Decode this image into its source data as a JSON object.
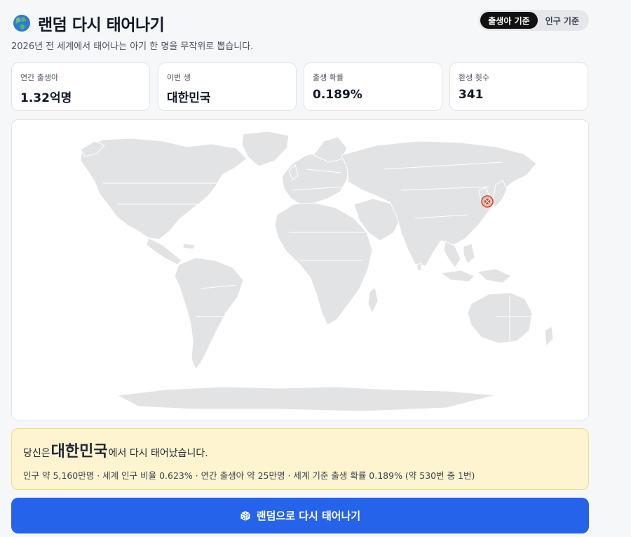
{
  "header": {
    "title": "랜덤 다시 태어나기",
    "subtitle": "2026년 전 세계에서 태어나는 아기 한 명을 무작위로 뽑습니다.",
    "toggle": [
      {
        "label": "출생아 기준",
        "active": true
      },
      {
        "label": "인구 기준",
        "active": false
      }
    ]
  },
  "stats": [
    {
      "label": "연간 출생아",
      "value": "1.32억명"
    },
    {
      "label": "이번 생",
      "value": "대한민국"
    },
    {
      "label": "출생 확률",
      "value": "0.189%"
    },
    {
      "label": "환생 횟수",
      "value": "341"
    }
  ],
  "map": {
    "land_color": "#e2e3e5",
    "marker_color": "#d9442c",
    "marker_icon": "location-pin-icon"
  },
  "result": {
    "prefix": "당신은 ",
    "country": "대한민국",
    "suffix": "에서 다시 태어났습니다.",
    "detail": "인구 약 5,160만명 · 세계 인구 비율 0.623% · 연간 출생아 약 25만명 · 세계 기준 출생 확률 0.189% (약 530번 중 1번)"
  },
  "cta": {
    "icon": "dice-icon",
    "label": "랜덤으로 다시 태어나기"
  },
  "colors": {
    "primary": "#2563eb",
    "result_bg": "#fef4cf",
    "toggle_active": "#111111"
  }
}
